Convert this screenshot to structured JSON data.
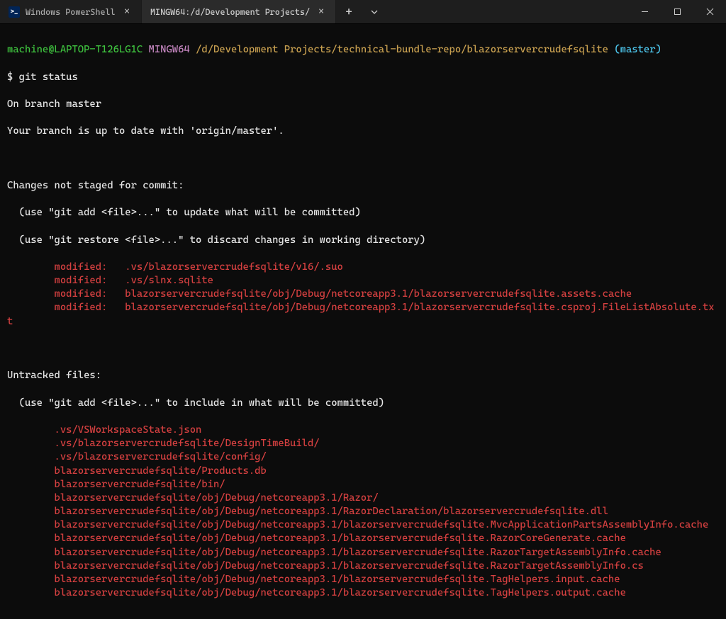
{
  "tabs": [
    {
      "title": "Windows PowerShell",
      "active": false,
      "icon": "powershell"
    },
    {
      "title": "MINGW64:/d/Development Projects/",
      "active": true,
      "icon": "bash"
    }
  ],
  "prompt": {
    "user": "machine@LAPTOP-T126LG1C",
    "shell": "MINGW64",
    "path": "/d/Development Projects/technical-bundle-repo/blazorservercrudefsqlite",
    "branch": "(master)"
  },
  "command": "$ git status",
  "status": {
    "branchLine": "On branch master",
    "upToDate": "Your branch is up to date with 'origin/master'.",
    "notStagedHeader": "Changes not staged for commit:",
    "hint1": "  (use \"git add <file>...\" to update what will be committed)",
    "hint2": "  (use \"git restore <file>...\" to discard changes in working directory)",
    "modified": [
      "modified:   .vs/blazorservercrudefsqlite/v16/.suo",
      "modified:   .vs/slnx.sqlite",
      "modified:   blazorservercrudefsqlite/obj/Debug/netcoreapp3.1/blazorservercrudefsqlite.assets.cache",
      "modified:   blazorservercrudefsqlite/obj/Debug/netcoreapp3.1/blazorservercrudefsqlite.csproj.FileListAbsolute.txt"
    ],
    "untrackedHeader": "Untracked files:",
    "hint3": "  (use \"git add <file>...\" to include in what will be committed)",
    "untracked": [
      ".vs/VSWorkspaceState.json",
      ".vs/blazorservercrudefsqlite/DesignTimeBuild/",
      ".vs/blazorservercrudefsqlite/config/",
      "blazorservercrudefsqlite/Products.db",
      "blazorservercrudefsqlite/bin/",
      "blazorservercrudefsqlite/obj/Debug/netcoreapp3.1/Razor/",
      "blazorservercrudefsqlite/obj/Debug/netcoreapp3.1/RazorDeclaration/blazorservercrudefsqlite.dll",
      "blazorservercrudefsqlite/obj/Debug/netcoreapp3.1/blazorservercrudefsqlite.MvcApplicationPartsAssemblyInfo.cache",
      "blazorservercrudefsqlite/obj/Debug/netcoreapp3.1/blazorservercrudefsqlite.RazorCoreGenerate.cache",
      "blazorservercrudefsqlite/obj/Debug/netcoreapp3.1/blazorservercrudefsqlite.RazorTargetAssemblyInfo.cache",
      "blazorservercrudefsqlite/obj/Debug/netcoreapp3.1/blazorservercrudefsqlite.RazorTargetAssemblyInfo.cs",
      "blazorservercrudefsqlite/obj/Debug/netcoreapp3.1/blazorservercrudefsqlite.TagHelpers.input.cache",
      "blazorservercrudefsqlite/obj/Debug/netcoreapp3.1/blazorservercrudefsqlite.TagHelpers.output.cache"
    ]
  }
}
